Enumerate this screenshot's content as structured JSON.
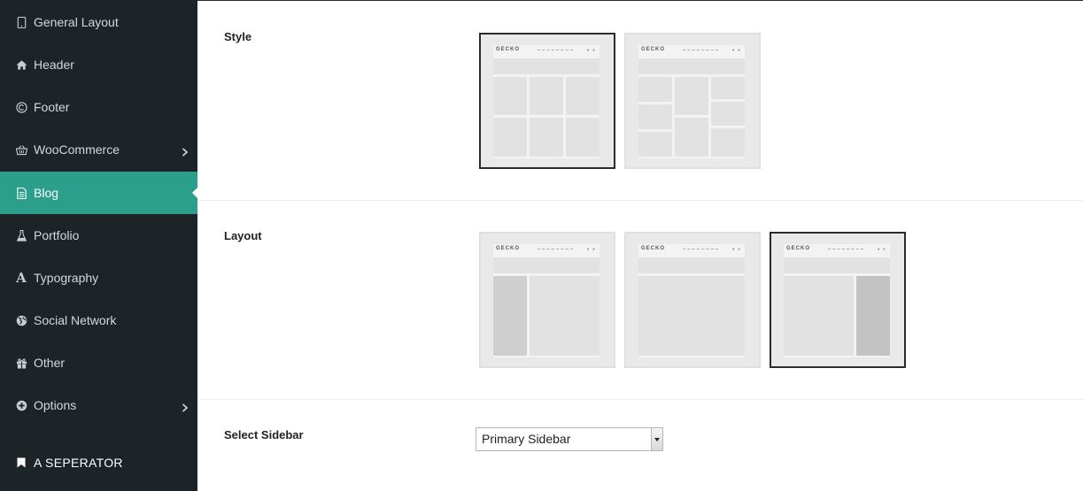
{
  "sidebar": {
    "items": [
      {
        "label": "General Layout",
        "icon": "tablet-icon"
      },
      {
        "label": "Header",
        "icon": "home-icon"
      },
      {
        "label": "Footer",
        "icon": "copyright-icon"
      },
      {
        "label": "WooCommerce",
        "icon": "basket-icon",
        "has_submenu": true
      },
      {
        "label": "Blog",
        "icon": "document-icon",
        "active": true
      },
      {
        "label": "Portfolio",
        "icon": "flask-icon"
      },
      {
        "label": "Typography",
        "icon": "font-icon"
      },
      {
        "label": "Social Network",
        "icon": "globe-icon"
      },
      {
        "label": "Other",
        "icon": "gift-icon"
      },
      {
        "label": "Options",
        "icon": "plus-circle-icon",
        "has_submenu": true
      }
    ],
    "separator": {
      "label": "A SEPERATOR",
      "icon": "bookmark-icon"
    }
  },
  "colors": {
    "sidebar_bg": "#1d2428",
    "active_bg": "#2c9f8c",
    "selected_border": "#2b2b2b"
  },
  "style_section": {
    "label": "Style",
    "options": [
      {
        "logo": "GECKO",
        "variant": "grid",
        "selected": true
      },
      {
        "logo": "GECKO",
        "variant": "masonry",
        "selected": false
      }
    ]
  },
  "layout_section": {
    "label": "Layout",
    "options": [
      {
        "logo": "GECKO",
        "variant": "left-sidebar",
        "selected": false
      },
      {
        "logo": "GECKO",
        "variant": "no-sidebar",
        "selected": false
      },
      {
        "logo": "GECKO",
        "variant": "right-sidebar",
        "selected": true
      }
    ]
  },
  "sidebar_select": {
    "label": "Select Sidebar",
    "value": "Primary Sidebar"
  }
}
